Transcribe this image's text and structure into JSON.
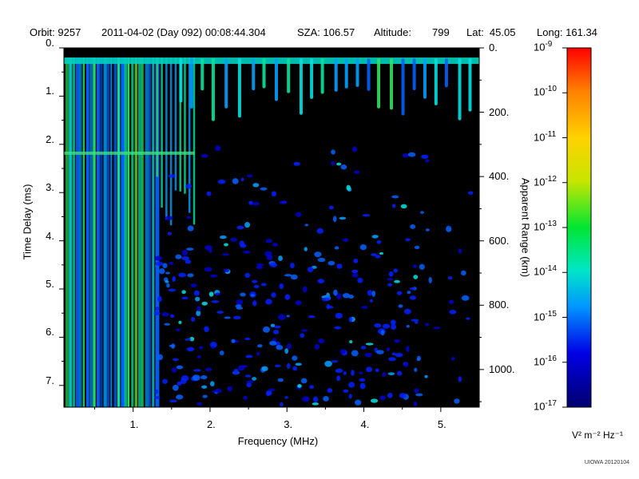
{
  "header": {
    "orbit": "Orbit: 9257",
    "datetime": "2011-04-02 (Day 092) 00:08:44.304",
    "sza": "SZA: 106.57",
    "altitude_label": "Altitude:",
    "altitude_value": "799",
    "lat": "Lat:  45.05",
    "long": "Long: 161.34"
  },
  "chart_data": {
    "type": "heatmap",
    "xlabel": "Frequency (MHz)",
    "ylabel": "Time Delay (ms)",
    "ylabel_right": "Apparent Range (km)",
    "xlim": [
      0.1,
      5.5
    ],
    "ylim": [
      7.45,
      0
    ],
    "x_ticks": [
      {
        "v": 1,
        "label": "1."
      },
      {
        "v": 2,
        "label": "2."
      },
      {
        "v": 3,
        "label": "3."
      },
      {
        "v": 4,
        "label": "4."
      },
      {
        "v": 5,
        "label": "5."
      }
    ],
    "y_ticks": [
      {
        "v": 0,
        "label": "0."
      },
      {
        "v": 1,
        "label": "1."
      },
      {
        "v": 2,
        "label": "2."
      },
      {
        "v": 3,
        "label": "3."
      },
      {
        "v": 4,
        "label": "4."
      },
      {
        "v": 5,
        "label": "5."
      },
      {
        "v": 6,
        "label": "6."
      },
      {
        "v": 7,
        "label": "7."
      }
    ],
    "right_ticks": [
      {
        "v": 0,
        "label": "0."
      },
      {
        "v": 200,
        "label": "200."
      },
      {
        "v": 400,
        "label": "400."
      },
      {
        "v": 600,
        "label": "600."
      },
      {
        "v": 800,
        "label": "800."
      },
      {
        "v": 1000,
        "label": "1000."
      }
    ],
    "right_range_km": [
      0,
      1117
    ],
    "colorbar": {
      "exponents": [
        -9,
        -10,
        -11,
        -12,
        -13,
        -14,
        -15,
        -16,
        -17
      ],
      "base": "10",
      "unit": "V² m⁻² Hz⁻¹",
      "scale": "log",
      "colors": [
        "#ff0000",
        "#ff8000",
        "#ffd200",
        "#c8e600",
        "#00e632",
        "#00e6c8",
        "#0096ff",
        "#0000e6",
        "#00006e"
      ]
    }
  },
  "footer": "UIOWA 20120104"
}
